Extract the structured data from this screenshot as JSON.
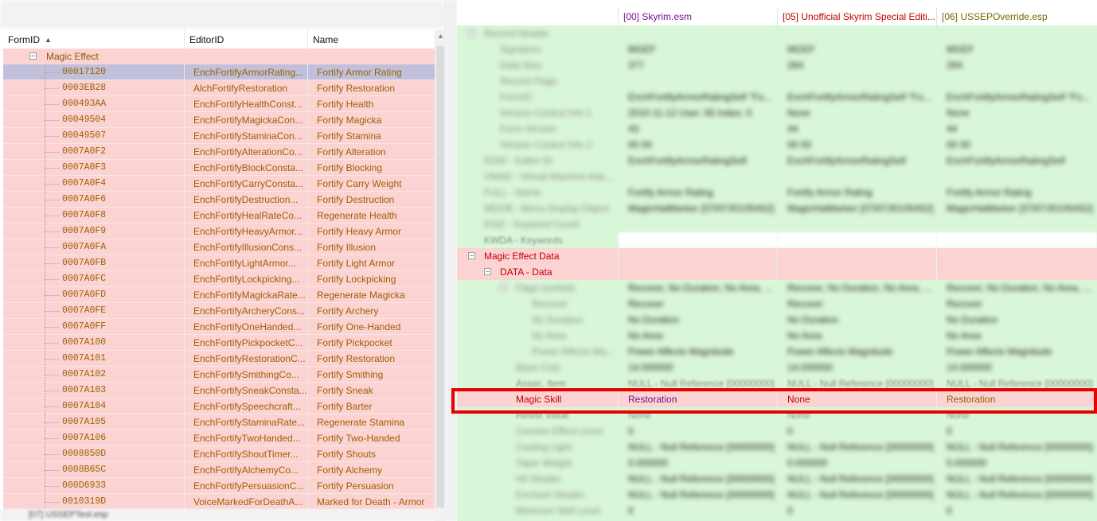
{
  "left": {
    "columns": {
      "formid": "FormID",
      "editorid": "EditorID",
      "name": "Name"
    },
    "group_label": "Magic Effect",
    "rows": [
      {
        "formid": "00017120",
        "editorid": "EnchFortifyArmorRating...",
        "name": "Fortify Armor Rating"
      },
      {
        "formid": "0003EB28",
        "editorid": "AlchFortifyRestoration",
        "name": "Fortify Restoration"
      },
      {
        "formid": "000493AA",
        "editorid": "EnchFortifyHealthConst...",
        "name": "Fortify Health"
      },
      {
        "formid": "00049504",
        "editorid": "EnchFortifyMagickaCon...",
        "name": "Fortify Magicka"
      },
      {
        "formid": "00049507",
        "editorid": "EnchFortifyStaminaCon...",
        "name": "Fortify Stamina"
      },
      {
        "formid": "0007A0F2",
        "editorid": "EnchFortifyAlterationCo...",
        "name": "Fortify Alteration"
      },
      {
        "formid": "0007A0F3",
        "editorid": "EnchFortifyBlockConsta...",
        "name": "Fortify Blocking"
      },
      {
        "formid": "0007A0F4",
        "editorid": "EnchFortifyCarryConsta...",
        "name": "Fortify Carry Weight"
      },
      {
        "formid": "0007A0F6",
        "editorid": "EnchFortifyDestruction...",
        "name": "Fortify Destruction"
      },
      {
        "formid": "0007A0F8",
        "editorid": "EnchFortifyHealRateCo...",
        "name": "Regenerate Health"
      },
      {
        "formid": "0007A0F9",
        "editorid": "EnchFortifyHeavyArmor...",
        "name": "Fortify Heavy Armor"
      },
      {
        "formid": "0007A0FA",
        "editorid": "EnchFortifyIllusionCons...",
        "name": "Fortify Illusion"
      },
      {
        "formid": "0007A0FB",
        "editorid": "EnchFortifyLightArmor...",
        "name": "Fortify Light Armor"
      },
      {
        "formid": "0007A0FC",
        "editorid": "EnchFortifyLockpicking...",
        "name": "Fortify Lockpicking"
      },
      {
        "formid": "0007A0FD",
        "editorid": "EnchFortifyMagickaRate...",
        "name": "Regenerate Magicka"
      },
      {
        "formid": "0007A0FE",
        "editorid": "EnchFortifyArcheryCons...",
        "name": "Fortify Archery"
      },
      {
        "formid": "0007A0FF",
        "editorid": "EnchFortifyOneHanded...",
        "name": "Fortify One-Handed"
      },
      {
        "formid": "0007A100",
        "editorid": "EnchFortifyPickpocketC...",
        "name": "Fortify Pickpocket"
      },
      {
        "formid": "0007A101",
        "editorid": "EnchFortifyRestorationC...",
        "name": "Fortify Restoration"
      },
      {
        "formid": "0007A102",
        "editorid": "EnchFortifySmithingCo...",
        "name": "Fortify Smithing"
      },
      {
        "formid": "0007A103",
        "editorid": "EnchFortifySneakConsta...",
        "name": "Fortify Sneak"
      },
      {
        "formid": "0007A104",
        "editorid": "EnchFortifySpeechcraft...",
        "name": "Fortify Barter"
      },
      {
        "formid": "0007A105",
        "editorid": "EnchFortifyStaminaRate...",
        "name": "Regenerate Stamina"
      },
      {
        "formid": "0007A106",
        "editorid": "EnchFortifyTwoHanded...",
        "name": "Fortify Two-Handed"
      },
      {
        "formid": "0008850D",
        "editorid": "EnchFortifyShoutTimer...",
        "name": "Fortify Shouts"
      },
      {
        "formid": "0008B65C",
        "editorid": "EnchFortifyAlchemyCo...",
        "name": "Fortify Alchemy"
      },
      {
        "formid": "000D6933",
        "editorid": "EnchFortifyPersuasionC...",
        "name": "Fortify Persuasion"
      },
      {
        "formid": "0010319D",
        "editorid": "VoiceMarkedForDeathA...",
        "name": "Marked for Death - Armor"
      }
    ],
    "bottom_item": "[07] USSEPTest.esp"
  },
  "right": {
    "columns": [
      "",
      "[00] Skyrim.esm",
      "[05] Unofficial Skyrim Special Editi...",
      "[06] USSEPOverride.esp"
    ],
    "rows_top": [
      {
        "label": "Record Header",
        "v": [
          "",
          "",
          ""
        ]
      },
      {
        "label": "Signature",
        "v": [
          "MGEF",
          "MGEF",
          "MGEF"
        ]
      },
      {
        "label": "Data Size",
        "v": [
          "377",
          "284",
          "284"
        ]
      },
      {
        "label": "Record Flags",
        "v": [
          "",
          "",
          ""
        ]
      },
      {
        "label": "FormID",
        "v": [
          "EnchFortifyArmorRatingSelf \"Fo...",
          "EnchFortifyArmorRatingSelf \"Fo...",
          "EnchFortifyArmorRatingSelf \"Fo..."
        ]
      },
      {
        "label": "Version Control Info 1",
        "v": [
          "2010-11-12 User: 65 Index: 0",
          "None",
          "None"
        ]
      },
      {
        "label": "Form Version",
        "v": [
          "43",
          "44",
          "44"
        ]
      },
      {
        "label": "Version Control Info 2",
        "v": [
          "00 00",
          "00 00",
          "00 00"
        ]
      },
      {
        "label": "EDID - Editor ID",
        "v": [
          "EnchFortifyArmorRatingSelf",
          "EnchFortifyArmorRatingSelf",
          "EnchFortifyArmorRatingSelf"
        ]
      },
      {
        "label": "VMAD - Virtual Machine Ada...",
        "v": [
          "",
          "",
          ""
        ]
      },
      {
        "label": "FULL - Name",
        "v": [
          "Fortify Armor Rating",
          "Fortify Armor Rating",
          "Fortify Armor Rating"
        ]
      },
      {
        "label": "MDOB - Menu Display Object",
        "v": [
          "MagicHatMarker [STAT:00105A52]",
          "MagicHatMarker [STAT:00105A52]",
          "MagicHatMarker [STAT:00105A52]"
        ]
      },
      {
        "label": "KSIZ - Keyword Count",
        "v": [
          "",
          "",
          ""
        ]
      }
    ],
    "kwda_label": "KWDA - Keywords",
    "mef_data_label": "Magic Effect Data",
    "data_label": "DATA - Data",
    "rows_mid": [
      {
        "label": "Flags (sorted)",
        "v": [
          "Recover, No Duration, No Area, ...",
          "Recover, No Duration, No Area, ...",
          "Recover, No Duration, No Area, ..."
        ]
      },
      {
        "label": "Recover",
        "v": [
          "Recover",
          "Recover",
          "Recover"
        ]
      },
      {
        "label": "No Duration",
        "v": [
          "No Duration",
          "No Duration",
          "No Duration"
        ]
      },
      {
        "label": "No Area",
        "v": [
          "No Area",
          "No Area",
          "No Area"
        ]
      },
      {
        "label": "Power Affects Ma...",
        "v": [
          "Power Affects Magnitude",
          "Power Affects Magnitude",
          "Power Affects Magnitude"
        ]
      },
      {
        "label": "Base Cost",
        "v": [
          "14.000000",
          "14.000000",
          "14.000000"
        ]
      }
    ],
    "assoc": {
      "label": "Assoc. Item",
      "v": [
        "NULL - Null Reference [00000000]",
        "NULL - Null Reference [00000000]",
        "NULL - Null Reference [00000000]"
      ]
    },
    "magic_skill": {
      "label": "Magic Skill",
      "v": [
        "Restoration",
        "None",
        "Restoration"
      ]
    },
    "resist": {
      "label": "Resist Value",
      "v": [
        "None",
        "None",
        "None"
      ]
    },
    "rows_bottom": [
      {
        "label": "Counter Effect count",
        "v": [
          "0",
          "0",
          "0"
        ]
      },
      {
        "label": "Casting Light",
        "v": [
          "NULL - Null Reference [00000000]",
          "NULL - Null Reference [00000000]",
          "NULL - Null Reference [00000000]"
        ]
      },
      {
        "label": "Taper Weight",
        "v": [
          "0.000000",
          "0.000000",
          "0.000000"
        ]
      },
      {
        "label": "Hit Shader",
        "v": [
          "NULL - Null Reference [00000000]",
          "NULL - Null Reference [00000000]",
          "NULL - Null Reference [00000000]"
        ]
      },
      {
        "label": "Enchant Shader",
        "v": [
          "NULL - Null Reference [00000000]",
          "NULL - Null Reference [00000000]",
          "NULL - Null Reference [00000000]"
        ]
      },
      {
        "label": "Minimum Skill Level",
        "v": [
          "0",
          "0",
          "0"
        ]
      }
    ]
  }
}
